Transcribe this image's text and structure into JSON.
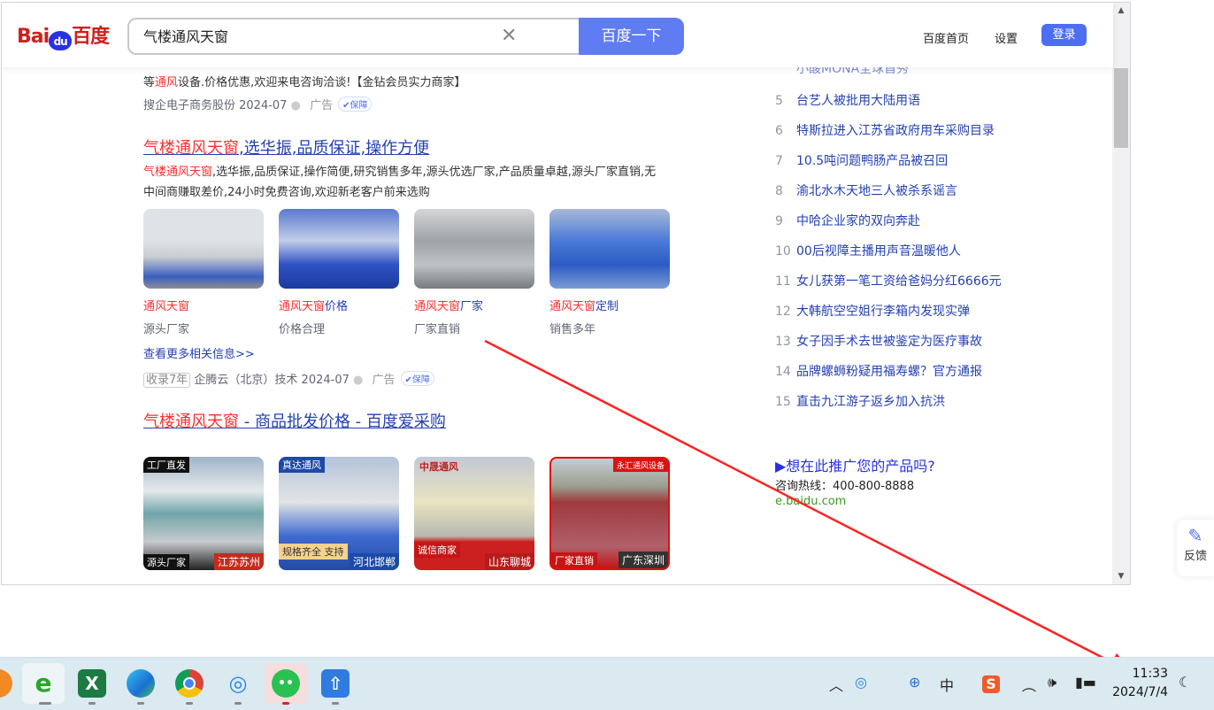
{
  "header": {
    "logo": "Bai du 百度",
    "search_value": "气楼通风天窗",
    "search_button": "百度一下",
    "links": [
      "百度首页",
      "设置"
    ],
    "login": "登录"
  },
  "ad1": {
    "desc_pre": "等",
    "desc_hl": "通风",
    "desc_post": "设备.价格优惠,欢迎来电咨询洽谈!【金钻会员实力商家】",
    "source": "搜企电子商务股份 2024-07",
    "ad": "广告",
    "guarantee": "保障"
  },
  "result2": {
    "title_hl": "气楼通风天窗",
    "title_rest": ",选华振,品质保证,操作方便",
    "desc_hl": "气楼通风天窗",
    "desc_rest": ",选华振,品质保证,操作简便,研究销售多年,源头优选厂家,产品质量卓越,源头厂家直销,无中间商赚取差价,24小时免费咨询,欢迎新老客户前来选购",
    "items": [
      {
        "hl": "通风天窗",
        "rest": "",
        "sub": "源头厂家"
      },
      {
        "hl": "通风天窗",
        "rest": "价格",
        "sub": "价格合理"
      },
      {
        "hl": "通风天窗",
        "rest": "厂家",
        "sub": "厂家直销"
      },
      {
        "hl": "通风天窗",
        "rest": "定制",
        "sub": "销售多年"
      }
    ],
    "more": "查看更多相关信息>>",
    "years": "收录7年",
    "source": "企腾云（北京）技术 2024-07",
    "ad": "广告",
    "guarantee": "保障"
  },
  "result3": {
    "title_hl": "气楼通风天窗",
    "title_rest": " - 商品批发价格 - 百度爱采购",
    "products": [
      {
        "tag": "工厂直发",
        "label": "源头厂家",
        "city": "江苏苏州"
      },
      {
        "tag": "真达通风",
        "label": "规格齐全 支持",
        "city": "河北邯郸"
      },
      {
        "tag": "中晟通风",
        "label": "诚信商家",
        "city": "山东聊城"
      },
      {
        "tag": "永汇通风设备",
        "label": "厂家直销",
        "city": "广东深圳"
      }
    ]
  },
  "hotlist": {
    "partial": "小酸MONA全球首秀",
    "items": [
      {
        "n": "5",
        "t": "台艺人被批用大陆用语"
      },
      {
        "n": "6",
        "t": "特斯拉进入江苏省政府用车采购目录"
      },
      {
        "n": "7",
        "t": "10.5吨问题鸭肠产品被召回"
      },
      {
        "n": "8",
        "t": "渝北水木天地三人被杀系谣言"
      },
      {
        "n": "9",
        "t": "中哈企业家的双向奔赴"
      },
      {
        "n": "10",
        "t": "00后视障主播用声音温暖他人"
      },
      {
        "n": "11",
        "t": "女儿获第一笔工资给爸妈分红6666元"
      },
      {
        "n": "12",
        "t": "大韩航空空姐行李箱内发现实弹"
      },
      {
        "n": "13",
        "t": "女子因手术去世被鉴定为医疗事故"
      },
      {
        "n": "14",
        "t": "品牌螺蛳粉疑用福寿螺？官方通报"
      },
      {
        "n": "15",
        "t": "直击九江游子返乡加入抗洪"
      }
    ]
  },
  "promo": {
    "title": "▶想在此推广您的产品吗?",
    "hotline": "咨询热线：400-800-8888",
    "url": "e.baidu.com"
  },
  "feedback": "反馈",
  "tray": {
    "ime": "中",
    "time": "11:33",
    "date": "2024/7/4"
  }
}
